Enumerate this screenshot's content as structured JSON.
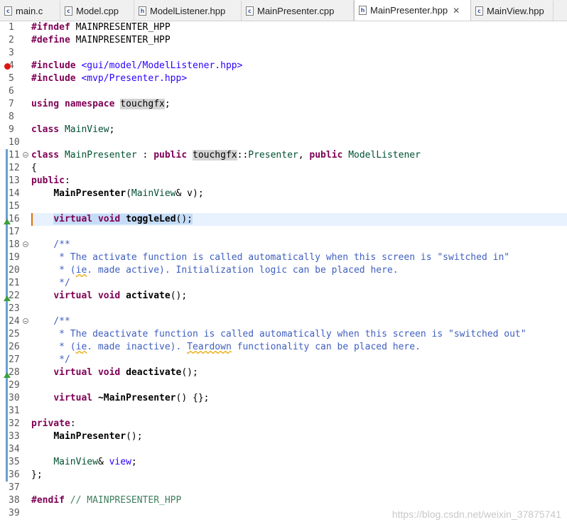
{
  "tabs": [
    {
      "label": "main.c",
      "icon": "c",
      "active": false
    },
    {
      "label": "Model.cpp",
      "icon": "c",
      "active": false
    },
    {
      "label": "ModelListener.hpp",
      "icon": "h",
      "active": false
    },
    {
      "label": "MainPresenter.cpp",
      "icon": "c",
      "active": false
    },
    {
      "label": "MainPresenter.hpp",
      "icon": "h",
      "active": true
    },
    {
      "label": "MainView.hpp",
      "icon": "c",
      "active": false
    }
  ],
  "close_glyph": "✕",
  "editor": {
    "line_numbers": [
      "1",
      "2",
      "3",
      "4",
      "5",
      "6",
      "7",
      "8",
      "9",
      "10",
      "11",
      "12",
      "13",
      "14",
      "15",
      "16",
      "17",
      "18",
      "19",
      "20",
      "21",
      "22",
      "23",
      "24",
      "25",
      "26",
      "27",
      "28",
      "29",
      "30",
      "31",
      "32",
      "33",
      "34",
      "35",
      "36",
      "37",
      "38",
      "39"
    ],
    "lines": [
      "#ifndef MAINPRESENTER_HPP",
      "#define MAINPRESENTER_HPP",
      "",
      "#include <gui/model/ModelListener.hpp>",
      "#include <mvp/Presenter.hpp>",
      "",
      "using namespace touchgfx;",
      "",
      "class MainView;",
      "",
      "class MainPresenter : public touchgfx::Presenter, public ModelListener",
      "{",
      "public:",
      "    MainPresenter(MainView& v);",
      "",
      "    virtual void toggleLed();",
      "",
      "    /**",
      "     * The activate function is called automatically when this screen is \"switched in\"",
      "     * (ie. made active). Initialization logic can be placed here.",
      "     */",
      "    virtual void activate();",
      "",
      "    /**",
      "     * The deactivate function is called automatically when this screen is \"switched out\"",
      "     * (ie. made inactive). Teardown functionality can be placed here.",
      "     */",
      "    virtual void deactivate();",
      "",
      "    virtual ~MainPresenter() {};",
      "",
      "private:",
      "    MainPresenter();",
      "",
      "    MainView& view;",
      "};",
      "",
      "#endif // MAINPRESENTER_HPP",
      ""
    ],
    "breakpoint_line": "4",
    "current_line": "16"
  },
  "watermark": "https://blog.csdn.net/weixin_37875741",
  "colors": {
    "keyword": "#7f0055",
    "include": "#2a00ff",
    "type": "#005032",
    "comment": "#3f5fbf",
    "line_comment": "#3f7f5f",
    "breakpoint": "#e0150f",
    "highlight": "#e8f2fe",
    "scope_bar": "#6a9fcf"
  }
}
